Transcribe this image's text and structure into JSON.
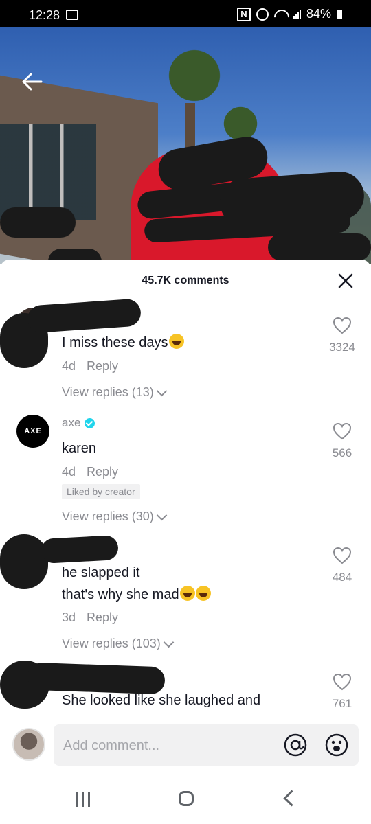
{
  "status_bar": {
    "time": "12:28",
    "nfc": "N",
    "battery": "84%"
  },
  "header": {
    "title": "45.7K comments"
  },
  "comments": [
    {
      "username": "",
      "avatar_text": "",
      "verified": false,
      "text_lines": [
        "I miss these days"
      ],
      "emoji_count": 1,
      "age": "4d",
      "reply_label": "Reply",
      "likes": "3324",
      "liked_by_creator": "",
      "view_replies": "View replies (13)"
    },
    {
      "username": "axe",
      "avatar_text": "AXE",
      "verified": true,
      "text_lines": [
        "karen"
      ],
      "emoji_count": 0,
      "age": "4d",
      "reply_label": "Reply",
      "likes": "566",
      "liked_by_creator": "Liked by creator",
      "view_replies": "View replies (30)"
    },
    {
      "username": "",
      "avatar_text": "",
      "verified": false,
      "text_lines": [
        "he slapped it",
        "that's why she mad"
      ],
      "emoji_count": 2,
      "age": "3d",
      "reply_label": "Reply",
      "likes": "484",
      "liked_by_creator": "",
      "view_replies": "View replies (103)"
    },
    {
      "username": "",
      "avatar_text": "",
      "verified": false,
      "text_lines": [
        "She looked like she laughed and"
      ],
      "emoji_count": 0,
      "age": "",
      "reply_label": "",
      "likes": "761",
      "liked_by_creator": "",
      "view_replies": ""
    }
  ],
  "comment_input": {
    "placeholder": "Add comment..."
  },
  "icons": {
    "back": "arrow-left-icon",
    "close": "close-icon",
    "heart": "heart-outline-icon",
    "at": "at-sign-icon",
    "emoji": "smiley-icon",
    "verified": "verified-check-icon"
  },
  "colors": {
    "accent_verified": "#20d5ec",
    "text_primary": "#161823",
    "text_secondary": "#8a8b91"
  }
}
